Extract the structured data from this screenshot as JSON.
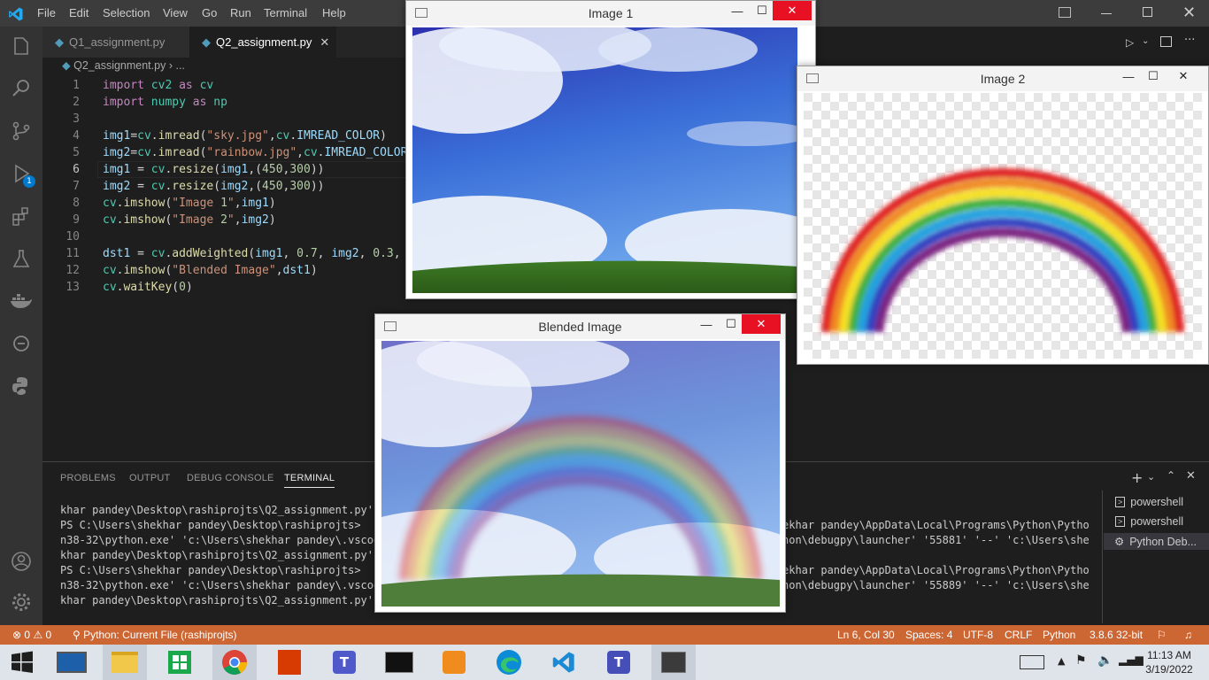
{
  "menu": [
    "File",
    "Edit",
    "Selection",
    "View",
    "Go",
    "Run",
    "Terminal",
    "Help"
  ],
  "tabs": [
    {
      "label": "Q1_assignment.py",
      "active": false
    },
    {
      "label": "Q2_assignment.py",
      "active": true
    }
  ],
  "breadcrumb": {
    "file": "Q2_assignment.py",
    "rest": "..."
  },
  "code_lines": [
    "import cv2 as cv",
    "import numpy as np",
    "",
    "img1=cv.imread(\"sky.jpg\",cv.IMREAD_COLOR)",
    "img2=cv.imread(\"rainbow.jpg\",cv.IMREAD_COLOR)",
    "img1 = cv.resize(img1,(450,300))",
    "img2 = cv.resize(img2,(450,300))",
    "cv.imshow(\"Image 1\",img1)",
    "cv.imshow(\"Image 2\",img2)",
    "",
    "dst1 = cv.addWeighted(img1, 0.7, img2, 0.3, 0",
    "cv.imshow(\"Blended Image\",dst1)",
    "cv.waitKey(0)"
  ],
  "line_numbers": [
    "1",
    "2",
    "3",
    "4",
    "5",
    "6",
    "7",
    "8",
    "9",
    "10",
    "11",
    "12",
    "13"
  ],
  "panel_tabs": [
    "PROBLEMS",
    "OUTPUT",
    "DEBUG CONSOLE",
    "TERMINAL"
  ],
  "terminal_left": [
    "khar pandey\\Desktop\\rashiprojts\\Q2_assignment.py'",
    "PS C:\\Users\\shekhar pandey\\Desktop\\rashiprojts>  c:",
    "n38-32\\python.exe' 'c:\\Users\\shekhar pandey\\.vscode",
    "khar pandey\\Desktop\\rashiprojts\\Q2_assignment.py'",
    "PS C:\\Users\\shekhar pandey\\Desktop\\rashiprojts>  c:",
    "n38-32\\python.exe' 'c:\\Users\\shekhar pandey\\.vscode",
    "khar pandey\\Desktop\\rashiprojts\\Q2_assignment.py'"
  ],
  "terminal_right": [
    "",
    "ekhar pandey\\AppData\\Local\\Programs\\Python\\Pytho",
    "hon\\debugpy\\launcher' '55881' '--' 'c:\\Users\\she",
    "",
    "ekhar pandey\\AppData\\Local\\Programs\\Python\\Pytho",
    "hon\\debugpy\\launcher' '55889' '--' 'c:\\Users\\she",
    ""
  ],
  "terminal_list": [
    "powershell",
    "powershell",
    "Python Deb..."
  ],
  "status": {
    "errors": "0",
    "warnings": "0",
    "run": "Python: Current File (rashiprojts)",
    "position": "Ln 6, Col 30",
    "spaces": "Spaces: 4",
    "encoding": "UTF-8",
    "eol": "CRLF",
    "language": "Python",
    "interpreter": "3.8.6 32-bit"
  },
  "debug_badge": "1",
  "windows": {
    "image1": "Image 1",
    "image2": "Image 2",
    "blended": "Blended Image"
  },
  "clock": {
    "time": "11:13 AM",
    "date": "3/19/2022"
  },
  "taskbar_apps": [
    "lenovo-icon",
    "file-explorer-icon",
    "store-icon",
    "chrome-icon",
    "office-icon",
    "teams-icon",
    "mysql-icon",
    "media-player-icon",
    "edge-icon",
    "vscode-icon",
    "teams-work-icon",
    "python-icon"
  ],
  "colors": {
    "statusbar": "#cc6633",
    "titlebar": "#3c3c3c",
    "editor": "#1e1e1e",
    "accent": "#007acc"
  }
}
